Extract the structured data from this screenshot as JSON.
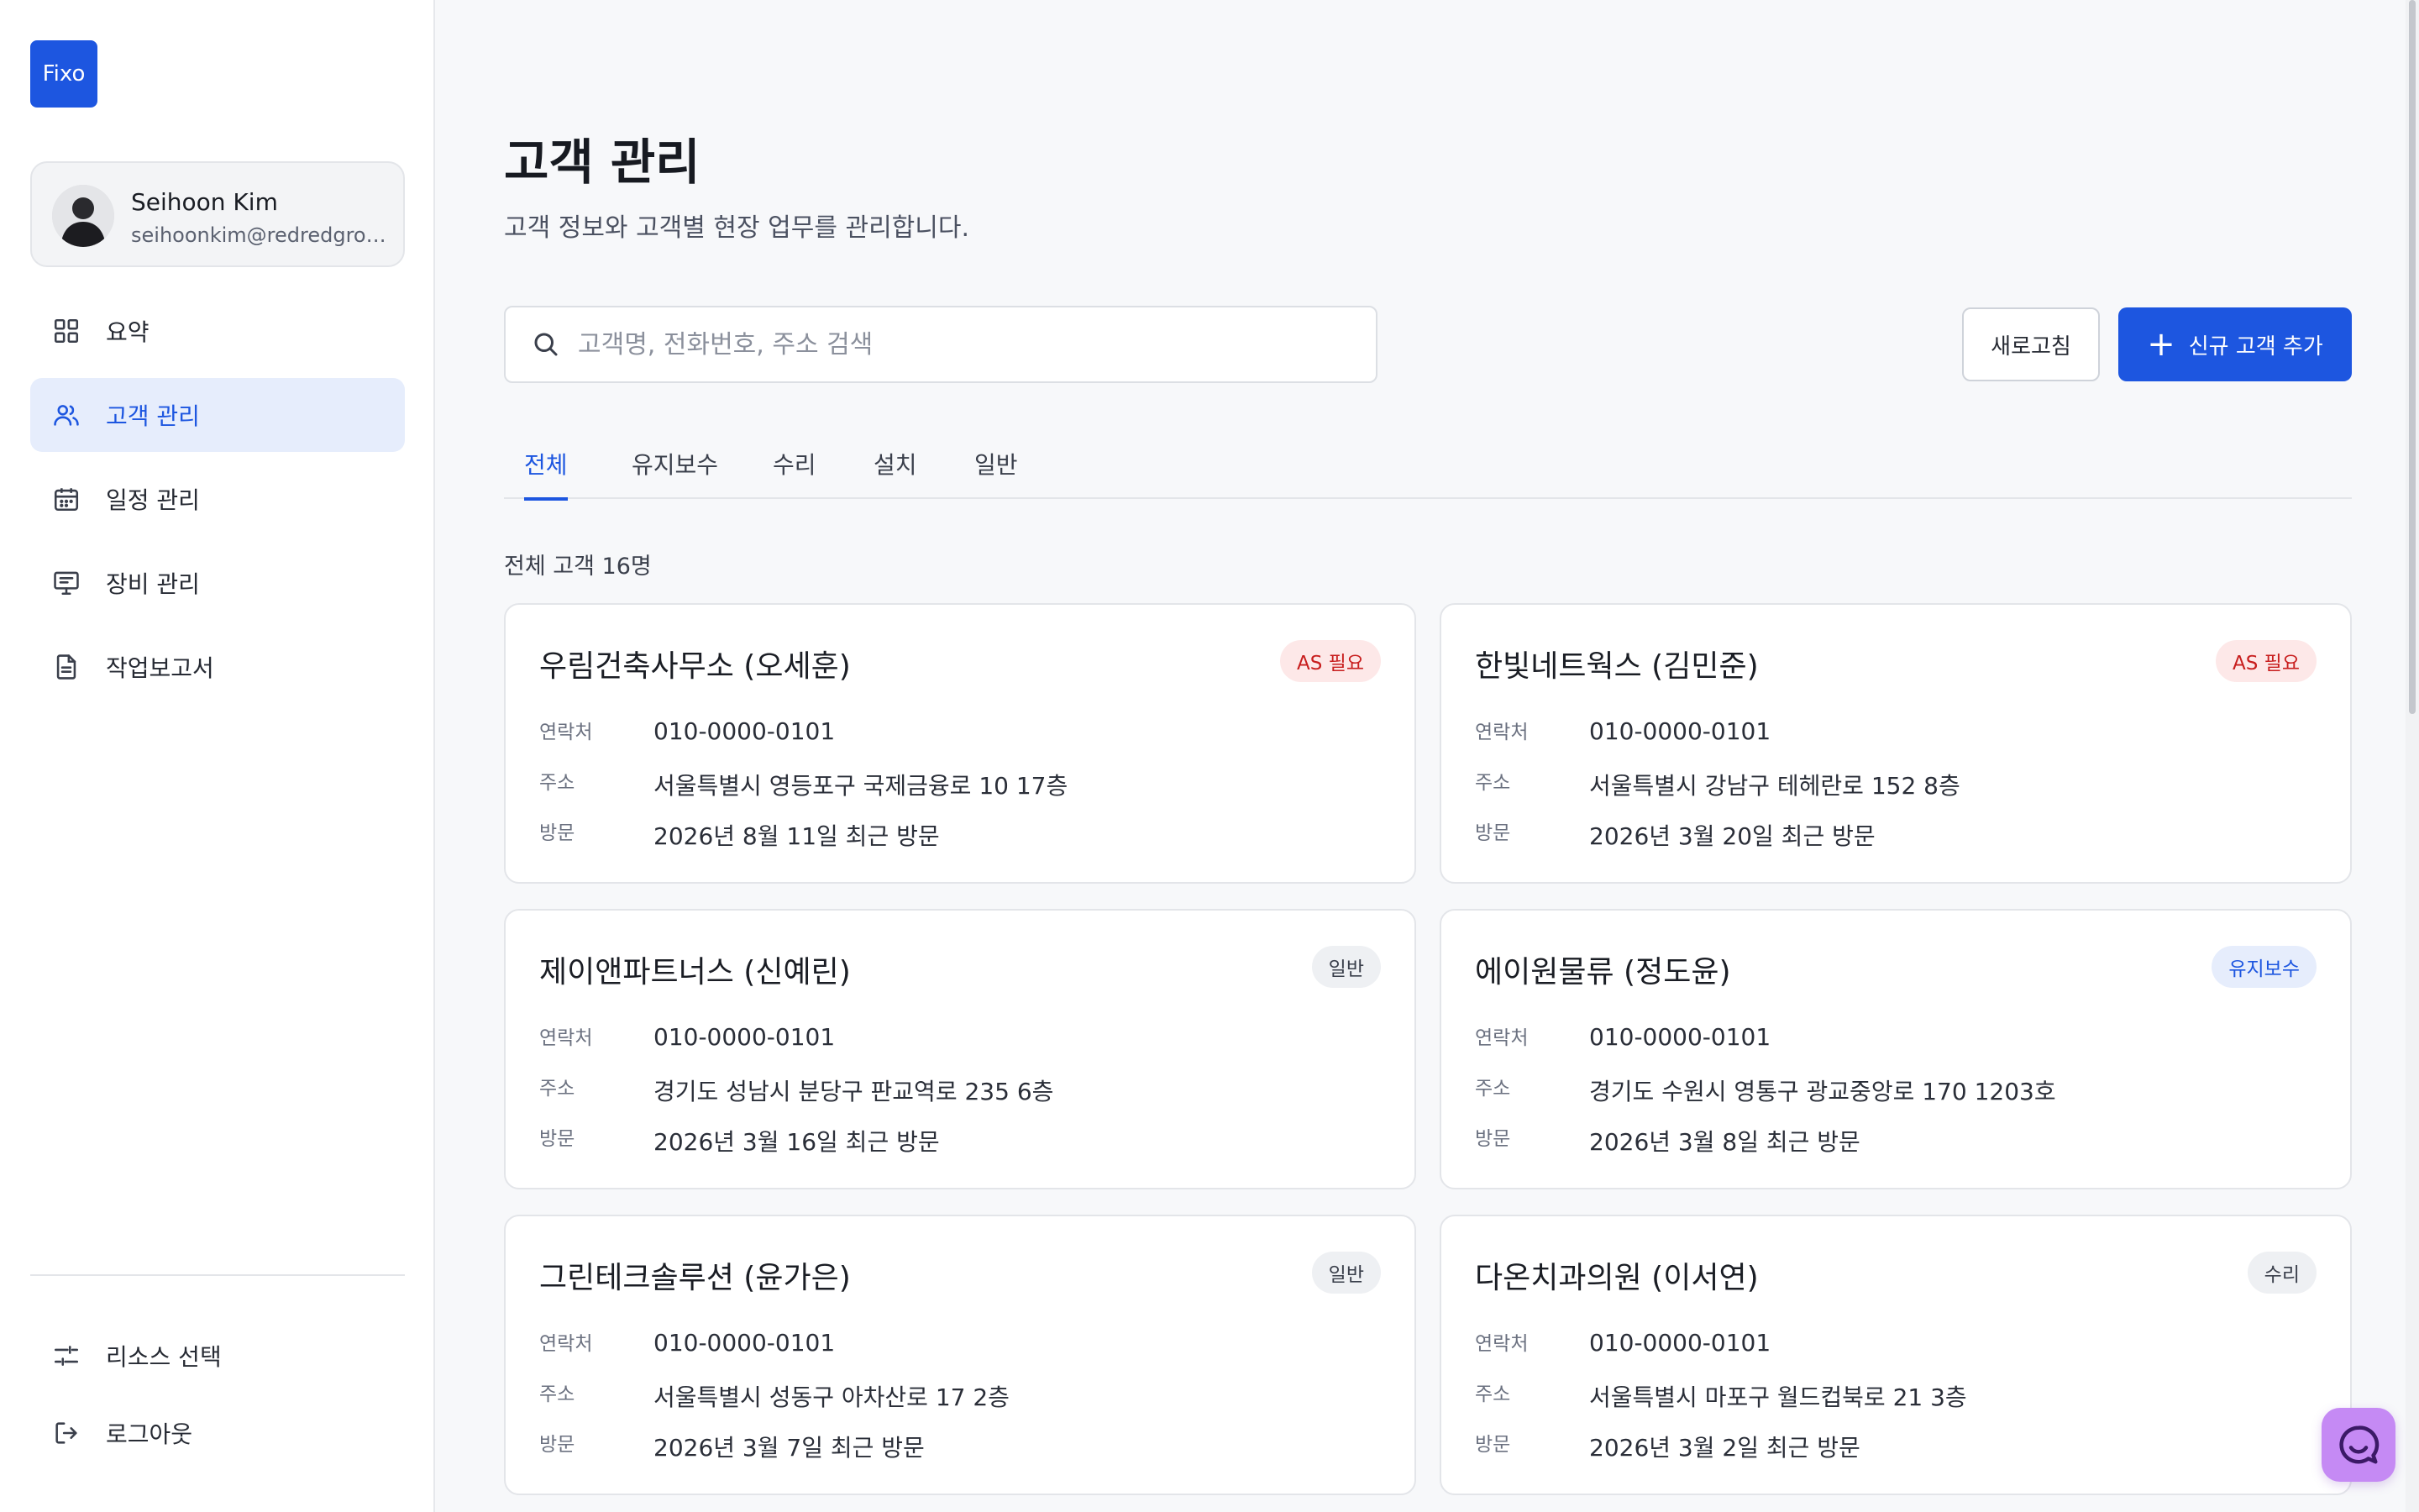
{
  "app": {
    "logo": "Fixo"
  },
  "profile": {
    "name": "Seihoon Kim",
    "email": "seihoonkim@redredgroup.com"
  },
  "sidebar": {
    "items": [
      {
        "label": "요약",
        "icon": "grid-icon",
        "active": false
      },
      {
        "label": "고객 관리",
        "icon": "users-icon",
        "active": true
      },
      {
        "label": "일정 관리",
        "icon": "calendar-icon",
        "active": false
      },
      {
        "label": "장비 관리",
        "icon": "monitor-icon",
        "active": false
      },
      {
        "label": "작업보고서",
        "icon": "document-icon",
        "active": false
      }
    ],
    "bottom": [
      {
        "label": "리소스 선택",
        "icon": "sliders-icon"
      },
      {
        "label": "로그아웃",
        "icon": "logout-icon"
      }
    ]
  },
  "header": {
    "title": "고객 관리",
    "subtitle": "고객 정보와 고객별 현장 업무를 관리합니다."
  },
  "search": {
    "placeholder": "고객명, 전화번호, 주소 검색",
    "value": ""
  },
  "actions": {
    "refresh_label": "새로고침",
    "add_label": "신규 고객 추가"
  },
  "tabs": [
    {
      "label": "전체",
      "active": true
    },
    {
      "label": "유지보수",
      "active": false
    },
    {
      "label": "수리",
      "active": false
    },
    {
      "label": "설치",
      "active": false
    },
    {
      "label": "일반",
      "active": false
    }
  ],
  "count_label": "전체 고객 16명",
  "field_labels": {
    "contact": "연락처",
    "address": "주소",
    "visit": "방문"
  },
  "customers": [
    {
      "name": "우림건축사무소 (오세훈)",
      "badge": "AS 필요",
      "badge_type": "as",
      "phone": "010-0000-0101",
      "address": "서울특별시 영등포구 국제금융로 10 17층",
      "visit": "2026년 8월 11일 최근 방문"
    },
    {
      "name": "한빛네트웍스 (김민준)",
      "badge": "AS 필요",
      "badge_type": "as",
      "phone": "010-0000-0101",
      "address": "서울특별시 강남구 테헤란로 152 8층",
      "visit": "2026년 3월 20일 최근 방문"
    },
    {
      "name": "제이앤파트너스 (신예린)",
      "badge": "일반",
      "badge_type": "general",
      "phone": "010-0000-0101",
      "address": "경기도 성남시 분당구 판교역로 235 6층",
      "visit": "2026년 3월 16일 최근 방문"
    },
    {
      "name": "에이원물류 (정도윤)",
      "badge": "유지보수",
      "badge_type": "maint",
      "phone": "010-0000-0101",
      "address": "경기도 수원시 영통구 광교중앙로 170 1203호",
      "visit": "2026년 3월 8일 최근 방문"
    },
    {
      "name": "그린테크솔루션 (윤가은)",
      "badge": "일반",
      "badge_type": "general",
      "phone": "010-0000-0101",
      "address": "서울특별시 성동구 아차산로 17 2층",
      "visit": "2026년 3월 7일 최근 방문"
    },
    {
      "name": "다온치과의원 (이서연)",
      "badge": "수리",
      "badge_type": "repair",
      "phone": "010-0000-0101",
      "address": "서울특별시 마포구 월드컵북로 21 3층",
      "visit": "2026년 3월 2일 최근 방문"
    }
  ],
  "colors": {
    "accent": "#1d56e0",
    "as_badge": "#c81e1e",
    "chat_fab": "#c58af4"
  }
}
